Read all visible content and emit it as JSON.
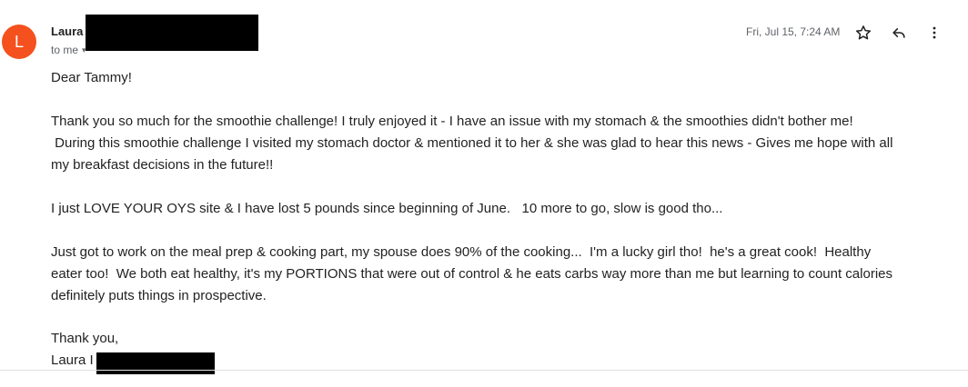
{
  "sender": {
    "avatar_letter": "L",
    "avatar_color": "#f4511e",
    "name": "Laura",
    "to_label": "to me"
  },
  "header": {
    "timestamp": "Fri, Jul 15, 7:24 AM",
    "icons": [
      "star-icon",
      "reply-icon",
      "more-vert-icon"
    ]
  },
  "body": {
    "greeting": "Dear Tammy!",
    "paragraph1_line1": "Thank you so much for the smoothie challenge!  I truly enjoyed it - I have an issue with my stomach & the smoothies didn't bother me!",
    "paragraph1_line2": " During this smoothie challenge I visited my stomach doctor & mentioned it to her & she was glad to hear this news - Gives me hope with all",
    "paragraph1_line3": "my breakfast decisions in the future!!",
    "paragraph2": "I just LOVE YOUR OYS site & I have lost 5 pounds since beginning of June.   10 more to go, slow is good tho...",
    "paragraph3_line1": "Just got to work on the meal prep & cooking part, my spouse does 90% of the cooking...  I'm a lucky girl tho!  he's a great cook!  Healthy",
    "paragraph3_line2": "eater too!  We both eat healthy, it's my PORTIONS that were out of control & he eats carbs way more than me but learning to count calories",
    "paragraph3_line3": "definitely puts things in prospective.",
    "closing": "Thank you,",
    "signature": "Laura I"
  }
}
